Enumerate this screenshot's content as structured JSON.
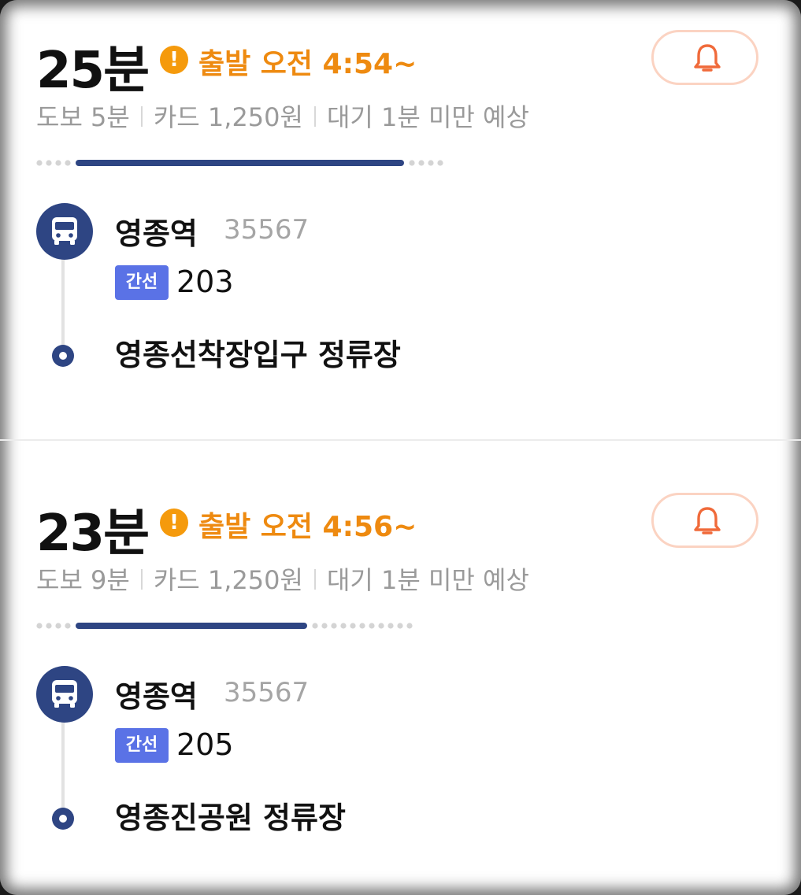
{
  "routes": [
    {
      "duration": "25분",
      "depart": "출발 오전 4:54~",
      "walk": "도보 5분",
      "fare": "카드 1,250원",
      "wait": "대기 1분 미만 예상",
      "progress": {
        "walk_before_dots": 4,
        "bus_fraction": 0.78,
        "walk_after_dots": 4
      },
      "start_stop": "영종역",
      "stop_id": "35567",
      "bus_type": "간선",
      "bus_number": "203",
      "end_stop": "영종선착장입구 정류장"
    },
    {
      "duration": "23분",
      "depart": "출발 오전 4:56~",
      "walk": "도보 9분",
      "fare": "카드 1,250원",
      "wait": "대기 1분 미만 예상",
      "progress": {
        "walk_before_dots": 4,
        "bus_fraction": 0.55,
        "walk_after_dots": 11
      },
      "start_stop": "영종역",
      "stop_id": "35567",
      "bus_type": "간선",
      "bus_number": "205",
      "end_stop": "영종진공원 정류장"
    }
  ],
  "icons": {
    "warning": "exclamation-circle-icon",
    "alarm": "bell-icon",
    "bus": "bus-icon"
  },
  "colors": {
    "accent_orange": "#ee8a10",
    "navy": "#2e4583",
    "badge_blue": "#5a72e6",
    "alarm_red": "#f06a3a"
  }
}
